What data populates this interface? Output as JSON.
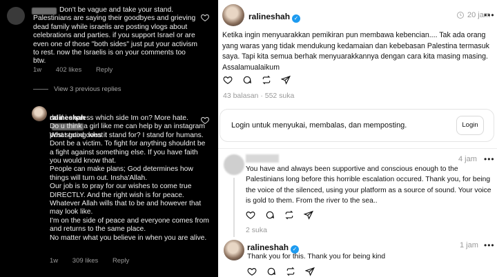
{
  "left": {
    "comment1": {
      "text": "Don't be vague and take your stand. Palestinians are saying their goodbyes and grieving dead family while israelis are posting vlogs about celebrations and parties. if you support Israel or are even one of those \"both sides\" just put your activism to rest. now the Israelis is on your comments too btw.",
      "time": "1w",
      "likes": "402 likes",
      "reply": "Reply"
    },
    "view_previous": "View 3 previous replies",
    "comment2": {
      "username": "ralineshah",
      "text_start": "What good does it",
      "text": "do if i express which side Im on? More hate.\nDo u think a girl like me can help by an instagram post stating what I stand for? I stand for humans. Dont be a victim. To fight for anything shouldnt be a fight against something else. If you have faith you would know that.\nPeople can make plans; God determines how things will turn out. Insha'Allah.\nOur job is to pray for our wishes to come true DIRECTLY. And the right wish is for peace. Whatever Allah wills that to be and however that may look like.\nI'm on the side of peace and everyone comes from and returns to the same place.\nNo matter what you believe in when you are alive.",
      "time": "1w",
      "likes": "309 likes",
      "reply": "Reply"
    }
  },
  "right": {
    "post": {
      "username": "ralineshah",
      "time": "20 jam",
      "more": "•••",
      "text": "Ketika ingin menyuarakkan pemikiran pun membawa kebencian.... Tak ada orang yang waras yang tidak mendukung kedamaian dan kebebasan Palestina termasuk saya. Tapi kita semua berhak menyuarakkannya dengan cara kita masing masing. Assalamualaikum",
      "replies": "43 balasan",
      "likes": "552 suka"
    },
    "login_card": {
      "label": "Login untuk menyukai, membalas, dan memposting.",
      "button": "Login"
    },
    "reply1": {
      "time": "4 jam",
      "more": "•••",
      "text": "You have and always been supportive and conscious enough to the Palestinians long before this horrible escalation occured. Thank you, for being the voice of the silenced, using your platform as a source of sound. Your voice is gold to them. From the river to the sea..",
      "likes": "2 suka"
    },
    "reply2": {
      "username": "ralineshah",
      "time": "1 jam",
      "more": "•••",
      "text": "Thank you for this. Thank you for being kind"
    }
  },
  "icons": [
    "heart-icon",
    "comment-icon",
    "repost-icon",
    "share-icon",
    "clock-icon",
    "verified-icon"
  ],
  "colors": {
    "left_bg": "#000000",
    "right_bg": "#ffffff",
    "verified": "#1d9bf0",
    "muted": "#999999"
  }
}
